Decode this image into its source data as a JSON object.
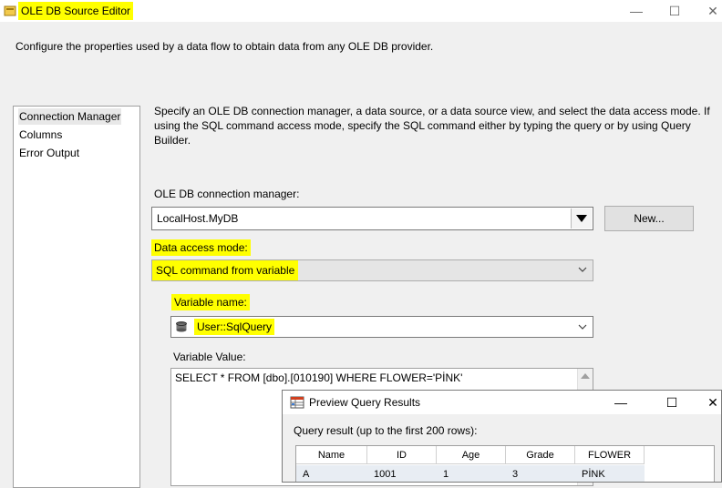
{
  "window": {
    "title": "OLE DB Source Editor",
    "minimize": "—",
    "maximize": "☐",
    "close": "✕"
  },
  "description": "Configure the properties used by a data flow to obtain data from any OLE DB provider.",
  "nav": {
    "items": [
      "Connection Manager",
      "Columns",
      "Error Output"
    ]
  },
  "main": {
    "instructions": "Specify an OLE DB connection manager, a data source, or a data source view, and select the data access mode. If using the SQL command access mode, specify the SQL command either by typing the query or by using Query Builder.",
    "connection_manager_label": "OLE DB connection manager:",
    "connection_manager_value": "LocalHost.MyDB",
    "new_button": "New...",
    "data_access_mode_label": "Data access mode:",
    "data_access_mode_value": "SQL command from variable",
    "variable_name_label": "Variable name:",
    "variable_name_value": "User::SqlQuery",
    "variable_value_label": "Variable Value:",
    "variable_value_text": "SELECT * FROM [dbo].[010190] WHERE FLOWER='PİNK'"
  },
  "preview": {
    "title": "Preview Query Results",
    "query_label": "Query result (up to the first 200 rows):",
    "columns": [
      "Name",
      "ID",
      "Age",
      "Grade",
      "FLOWER"
    ],
    "rows": [
      [
        "A",
        "1001",
        "1",
        "3",
        "PİNK"
      ]
    ],
    "minimize": "—",
    "maximize": "☐",
    "close": "✕"
  },
  "colors": {
    "highlight": "#ffff00",
    "window_bg": "#f0f0f0",
    "row_bg": "#e8edf3"
  },
  "icons": {
    "app": "ssis-source-icon",
    "variable": "variable-icon",
    "preview": "grid-icon"
  }
}
